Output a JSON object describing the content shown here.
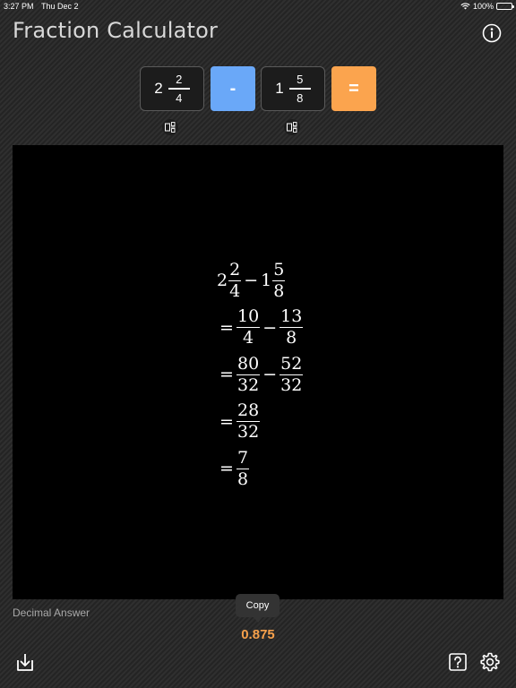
{
  "status": {
    "time": "3:27 PM",
    "date": "Thu Dec 2",
    "battery": "100%"
  },
  "header": {
    "title": "Fraction Calculator",
    "info_icon": "info-icon"
  },
  "input": {
    "operand1": {
      "whole": "2",
      "numerator": "2",
      "denominator": "4"
    },
    "operator": "-",
    "operand2": {
      "whole": "1",
      "numerator": "5",
      "denominator": "8"
    },
    "equals": "="
  },
  "solution": {
    "line1": {
      "w1": "2",
      "n1": "2",
      "d1": "4",
      "op": "−",
      "w2": "1",
      "n2": "5",
      "d2": "8"
    },
    "line2": {
      "eq": "=",
      "n1": "10",
      "d1": "4",
      "op": "−",
      "n2": "13",
      "d2": "8"
    },
    "line3": {
      "eq": "=",
      "n1": "80",
      "d1": "32",
      "op": "−",
      "n2": "52",
      "d2": "32"
    },
    "line4": {
      "eq": "=",
      "n1": "28",
      "d1": "32"
    },
    "line5": {
      "eq": "=",
      "n1": "7",
      "d1": "8"
    }
  },
  "decimal": {
    "label": "Decimal Answer",
    "copy_label": "Copy",
    "value": "0.875"
  },
  "colors": {
    "minus_button": "#6aa8f8",
    "equals_button": "#fba44e",
    "decimal_value": "#f6a04b"
  }
}
